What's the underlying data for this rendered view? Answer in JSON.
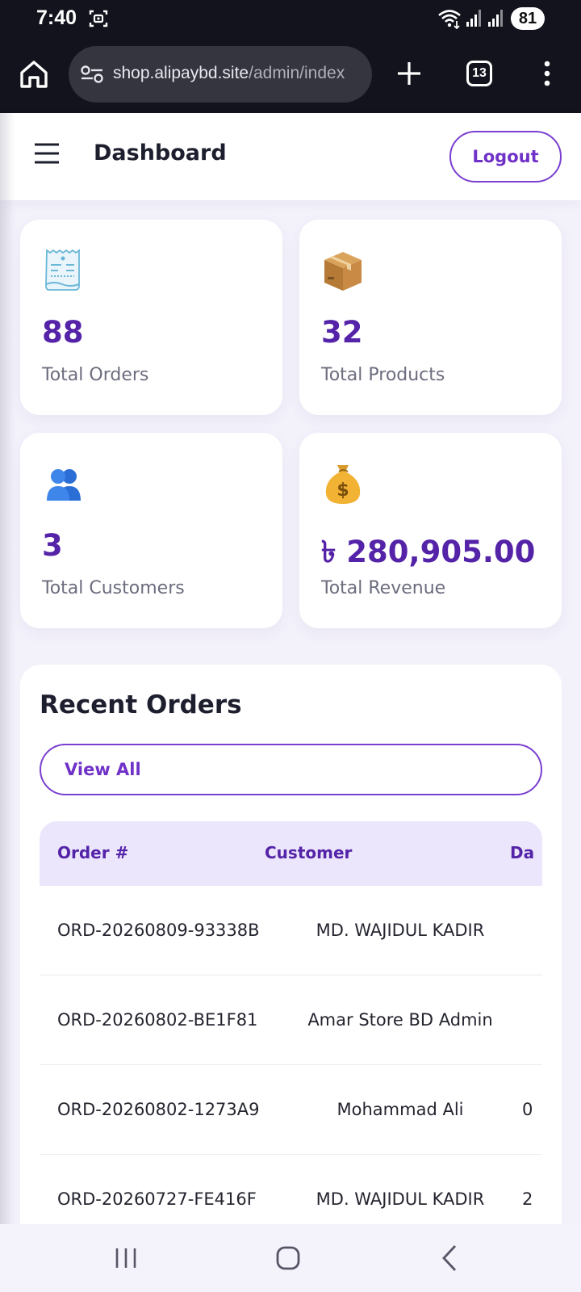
{
  "status_bar": {
    "time": "7:40",
    "battery": "81"
  },
  "browser": {
    "url_host": "shop.alipaybd.site",
    "url_path": "/admin/index",
    "tab_count": "13"
  },
  "header": {
    "title": "Dashboard",
    "logout_label": "Logout"
  },
  "stats": [
    {
      "icon": "receipt-icon",
      "value": "88",
      "label": "Total Orders"
    },
    {
      "icon": "package-icon",
      "value": "32",
      "label": "Total Products"
    },
    {
      "icon": "users-icon",
      "value": "3",
      "label": "Total Customers"
    },
    {
      "icon": "money-bag-icon",
      "value": "৳ 280,905.00",
      "label": "Total Revenue"
    }
  ],
  "recent_orders": {
    "title": "Recent Orders",
    "view_all_label": "View All",
    "columns": [
      "Order #",
      "Customer",
      "Da"
    ],
    "rows": [
      {
        "order": "ORD-20260809-93338B",
        "customer": "MD. WAJIDUL KADIR",
        "date": ""
      },
      {
        "order": "ORD-20260802-BE1F81",
        "customer": "Amar Store BD Admin",
        "date": ""
      },
      {
        "order": "ORD-20260802-1273A9",
        "customer": "Mohammad Ali",
        "date": "0"
      },
      {
        "order": "ORD-20260727-FE416F",
        "customer": "MD. WAJIDUL KADIR",
        "date": "2"
      }
    ]
  },
  "colors": {
    "accent": "#6f31c7",
    "stat_value": "#5423a8",
    "table_header_bg": "#ebe6fc",
    "browser_bar": "#12131c"
  }
}
